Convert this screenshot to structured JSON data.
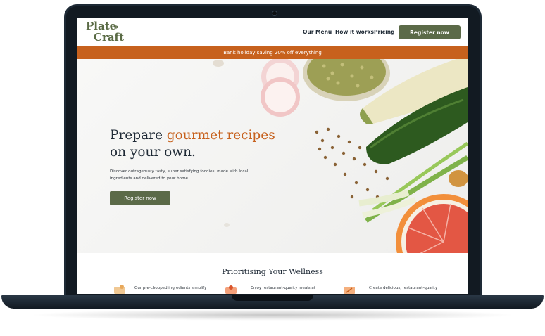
{
  "nav": {
    "logo_line1": "Plate",
    "logo_line2": "Craft",
    "links": [
      "Our Menu",
      "How it works",
      "Pricing"
    ],
    "cta": "Register now"
  },
  "banner": {
    "text": "Bank holiday saving 20% off everything"
  },
  "hero": {
    "title_part1": "Prepare ",
    "title_accent": "gourmet recipes",
    "title_part2": "on your own.",
    "description": "Discover outrageously tasty, super satisfying foodies, made with local ingredients and delivered to your home.",
    "button": "Register now"
  },
  "section": {
    "title": "Prioritising Your Wellness",
    "features": [
      "Our pre-chopped ingredients simplify",
      "Enjoy restaurant-quality meals at",
      "Create delicious, restaurant-quality"
    ]
  },
  "colors": {
    "brand_green": "#5b6a48",
    "accent_orange": "#c7611d",
    "dark_text": "#1f2a36"
  }
}
